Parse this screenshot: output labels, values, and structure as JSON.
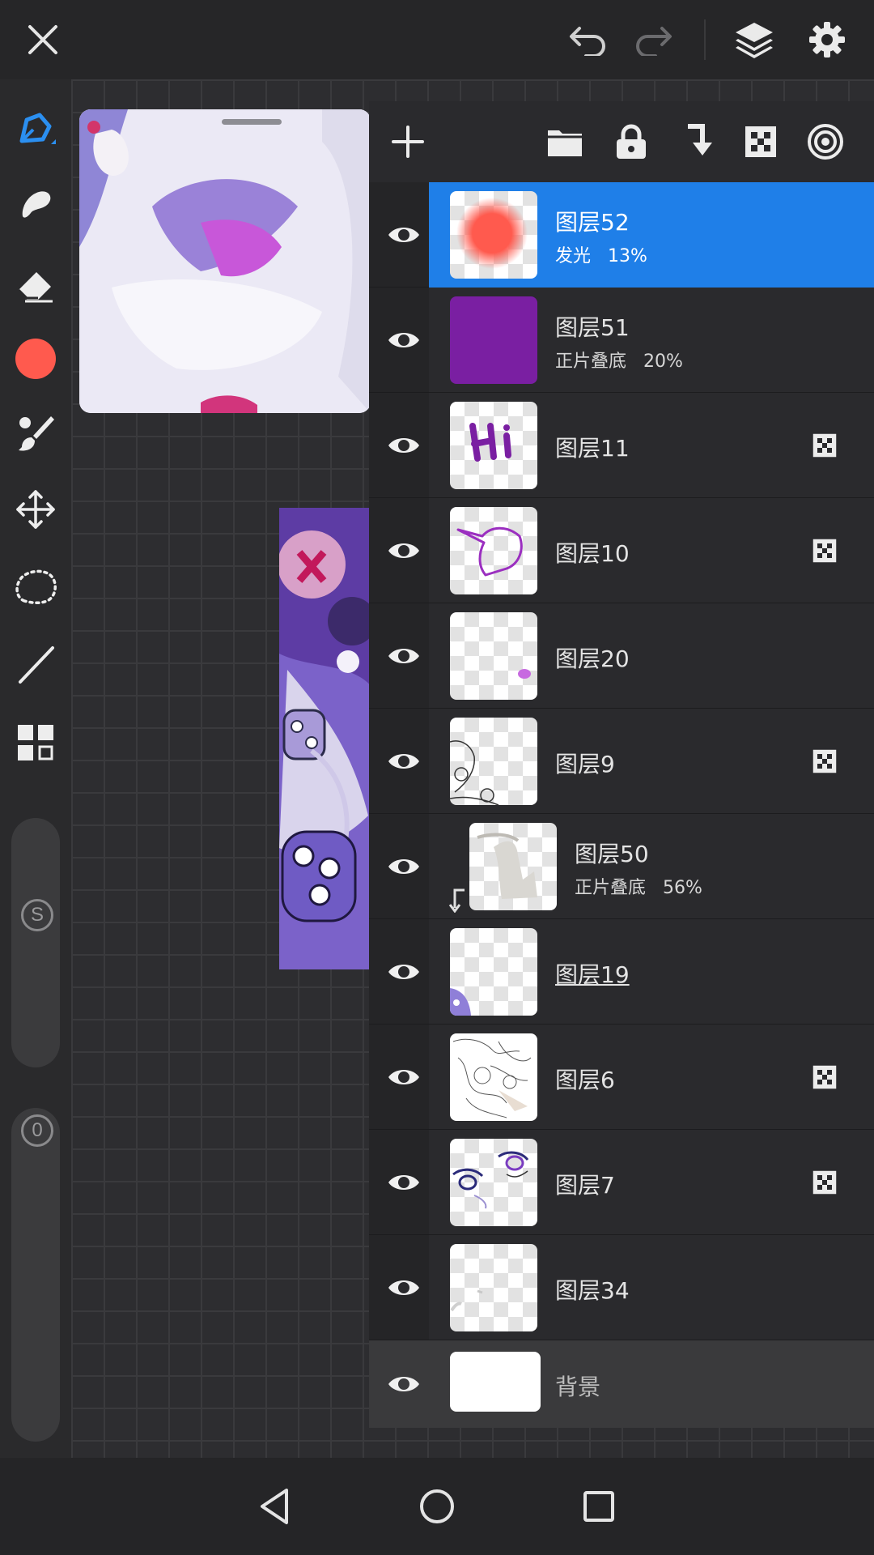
{
  "topbar": {
    "close_icon": "close-icon",
    "undo_icon": "undo-icon",
    "redo_icon": "redo-icon",
    "layers_icon": "layers-icon",
    "settings_icon": "gear-icon"
  },
  "tools": [
    "pen-icon",
    "smudge-icon",
    "eraser-icon",
    "color-swatch",
    "brush-settings-icon",
    "move-icon",
    "lasso-icon",
    "line-icon",
    "grid-icon"
  ],
  "colors": {
    "accent": "#1f7fe8",
    "current_color": "#ff5a4e",
    "panel": "#2a2a2d"
  },
  "sliders": {
    "size_label": "S",
    "opacity_label": "0"
  },
  "layers_panel": {
    "buttons": [
      "add-layer-icon",
      "folder-icon",
      "lock-icon",
      "clip-icon",
      "alpha-lock-icon",
      "blend-icon"
    ],
    "layers": [
      {
        "name": "图层52",
        "mode": "发光",
        "opacity": "13%",
        "selected": true
      },
      {
        "name": "图层51",
        "mode": "正片叠底",
        "opacity": "20%"
      },
      {
        "name": "图层11",
        "alpha_lock": true
      },
      {
        "name": "图层10",
        "alpha_lock": true
      },
      {
        "name": "图层20"
      },
      {
        "name": "图层9",
        "alpha_lock": true
      },
      {
        "name": "图层50",
        "mode": "正片叠底",
        "opacity": "56%",
        "clipped": true
      },
      {
        "name": "图层19"
      },
      {
        "name": "图层6",
        "alpha_lock": true
      },
      {
        "name": "图层7",
        "alpha_lock": true
      },
      {
        "name": "图层34"
      },
      {
        "name": "背景"
      }
    ]
  },
  "navbar": [
    "back-icon",
    "home-icon",
    "recents-icon"
  ]
}
